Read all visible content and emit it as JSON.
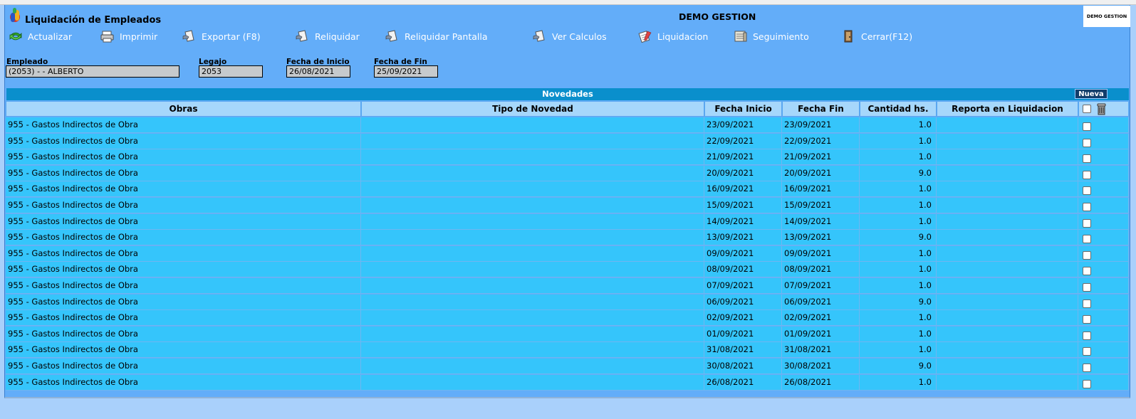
{
  "window": {
    "title": "Liquidación de Empleados",
    "company": "DEMO GESTION",
    "logo_text": "DEMO GESTION"
  },
  "toolbar": [
    {
      "label": "Actualizar",
      "icon": "refresh-icon"
    },
    {
      "label": "Imprimir",
      "icon": "printer-icon"
    },
    {
      "label": "Exportar (F8)",
      "icon": "export-icon"
    },
    {
      "label": "Reliquidar",
      "icon": "reliquidar-icon"
    },
    {
      "label": "Reliquidar Pantalla",
      "icon": "reliquidar-pantalla-icon"
    },
    {
      "label": "Ver Calculos",
      "icon": "calculos-icon"
    },
    {
      "label": "Liquidacion",
      "icon": "liquidacion-icon"
    },
    {
      "label": "Seguimiento",
      "icon": "seguimiento-icon"
    },
    {
      "label": "Cerrar(F12)",
      "icon": "close-icon"
    }
  ],
  "filters": {
    "empleado": {
      "label": "Empleado",
      "value": "(2053) - - ALBERTO"
    },
    "legajo": {
      "label": "Legajo",
      "value": "2053"
    },
    "fecha_inicio": {
      "label": "Fecha de Inicio",
      "value": "26/08/2021"
    },
    "fecha_fin": {
      "label": "Fecha de Fin",
      "value": "25/09/2021"
    }
  },
  "novedades": {
    "title": "Novedades",
    "new_button": "Nueva",
    "columns": [
      "Obras",
      "Tipo de Novedad",
      "Fecha Inicio",
      "Fecha Fin",
      "Cantidad hs.",
      "Reporta en Liquidacion"
    ],
    "rows": [
      [
        "955 - Gastos Indirectos de Obra",
        "",
        "23/09/2021",
        "23/09/2021",
        "1.0",
        ""
      ],
      [
        "955 - Gastos Indirectos de Obra",
        "",
        "22/09/2021",
        "22/09/2021",
        "1.0",
        ""
      ],
      [
        "955 - Gastos Indirectos de Obra",
        "",
        "21/09/2021",
        "21/09/2021",
        "1.0",
        ""
      ],
      [
        "955 - Gastos Indirectos de Obra",
        "",
        "20/09/2021",
        "20/09/2021",
        "9.0",
        ""
      ],
      [
        "955 - Gastos Indirectos de Obra",
        "",
        "16/09/2021",
        "16/09/2021",
        "1.0",
        ""
      ],
      [
        "955 - Gastos Indirectos de Obra",
        "",
        "15/09/2021",
        "15/09/2021",
        "1.0",
        ""
      ],
      [
        "955 - Gastos Indirectos de Obra",
        "",
        "14/09/2021",
        "14/09/2021",
        "1.0",
        ""
      ],
      [
        "955 - Gastos Indirectos de Obra",
        "",
        "13/09/2021",
        "13/09/2021",
        "9.0",
        ""
      ],
      [
        "955 - Gastos Indirectos de Obra",
        "",
        "09/09/2021",
        "09/09/2021",
        "1.0",
        ""
      ],
      [
        "955 - Gastos Indirectos de Obra",
        "",
        "08/09/2021",
        "08/09/2021",
        "1.0",
        ""
      ],
      [
        "955 - Gastos Indirectos de Obra",
        "",
        "07/09/2021",
        "07/09/2021",
        "1.0",
        ""
      ],
      [
        "955 - Gastos Indirectos de Obra",
        "",
        "06/09/2021",
        "06/09/2021",
        "9.0",
        ""
      ],
      [
        "955 - Gastos Indirectos de Obra",
        "",
        "02/09/2021",
        "02/09/2021",
        "1.0",
        ""
      ],
      [
        "955 - Gastos Indirectos de Obra",
        "",
        "01/09/2021",
        "01/09/2021",
        "1.0",
        ""
      ],
      [
        "955 - Gastos Indirectos de Obra",
        "",
        "31/08/2021",
        "31/08/2021",
        "1.0",
        ""
      ],
      [
        "955 - Gastos Indirectos de Obra",
        "",
        "30/08/2021",
        "30/08/2021",
        "9.0",
        ""
      ],
      [
        "955 - Gastos Indirectos de Obra",
        "",
        "26/08/2021",
        "26/08/2021",
        "1.0",
        ""
      ]
    ]
  }
}
